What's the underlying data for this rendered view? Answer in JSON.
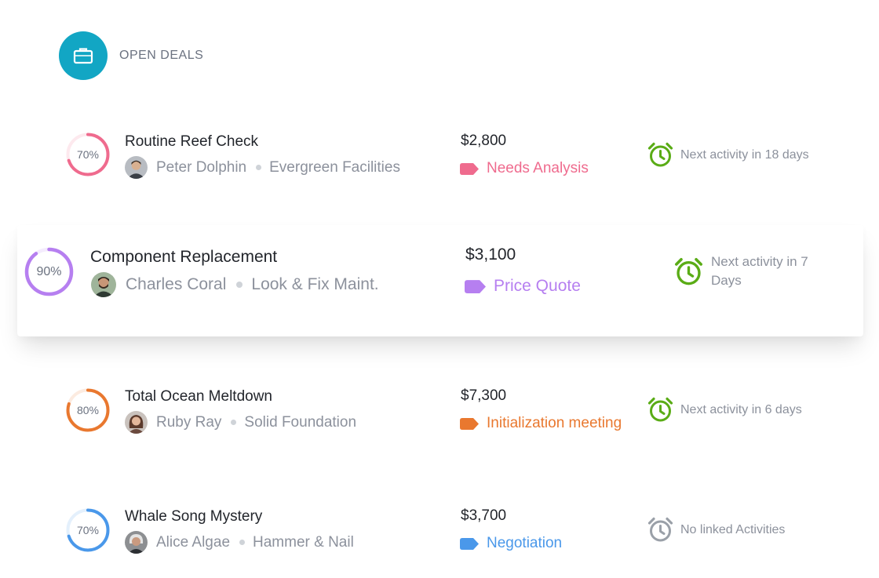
{
  "header": {
    "title": "OPEN DEALS",
    "icon": "briefcase-icon",
    "icon_bg": "#12a6c4"
  },
  "deals": [
    {
      "title": "Routine Reef Check",
      "progress": 0.7,
      "progress_label": "70%",
      "color": "#ef6b8e",
      "person": "Peter Dolphin",
      "company": "Evergreen Facilities",
      "amount": "$2,800",
      "stage": "Needs Analysis",
      "activity": "Next activity in 18 days",
      "activity_color": "#5aac16"
    },
    {
      "title": "Component Replacement",
      "progress": 0.9,
      "progress_label": "90%",
      "color": "#b67ff0",
      "person": "Charles Coral",
      "company": "Look & Fix Maint.",
      "amount": "$3,100",
      "stage": "Price Quote",
      "activity": "Next activity in 7 Days",
      "activity_color": "#5aac16"
    },
    {
      "title": "Total Ocean Meltdown",
      "progress": 0.8,
      "progress_label": "80%",
      "color": "#e9782f",
      "person": "Ruby Ray",
      "company": "Solid Foundation",
      "amount": "$7,300",
      "stage": "Initialization meeting",
      "activity": "Next activity in 6 days",
      "activity_color": "#5aac16"
    },
    {
      "title": "Whale Song Mystery",
      "progress": 0.7,
      "progress_label": "70%",
      "color": "#4a98ea",
      "person": "Alice Algae",
      "company": "Hammer & Nail",
      "amount": "$3,700",
      "stage": "Negotiation",
      "activity": "No linked Activities",
      "activity_color": "#9aa0a8"
    }
  ]
}
